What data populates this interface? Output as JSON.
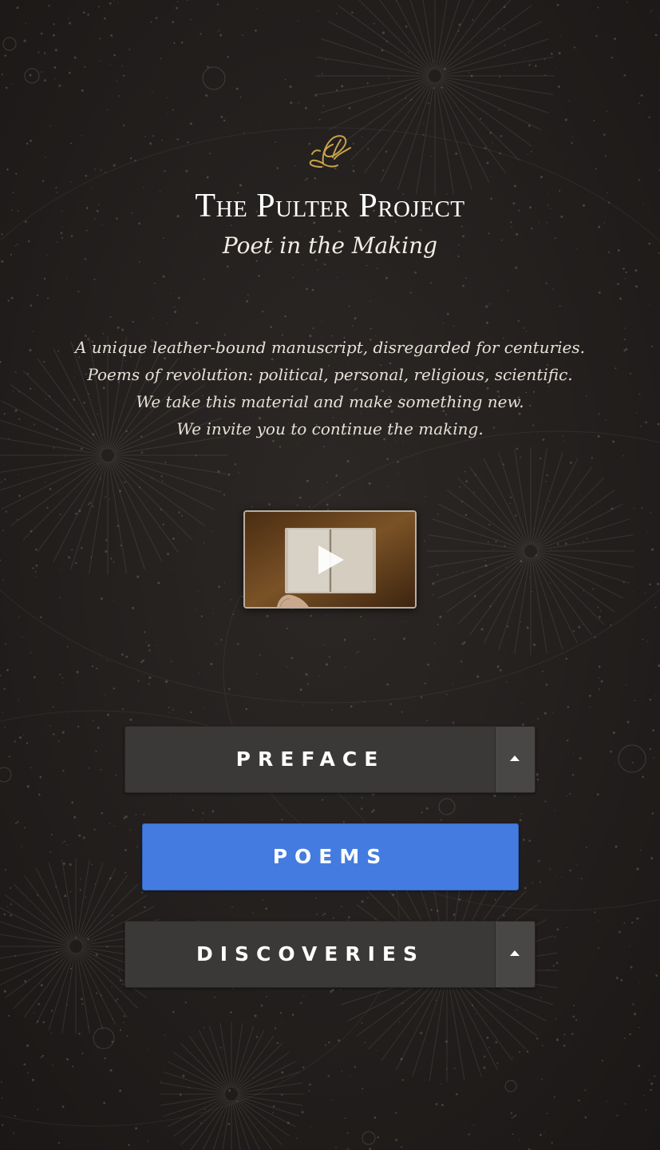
{
  "header": {
    "logo_icon": "quill-monogram-icon",
    "title": "The Pulter Project",
    "subtitle": "Poet in the Making"
  },
  "intro": {
    "lines": [
      "A unique leather-bound manuscript, disregarded for centuries.",
      "Poems of revolution: political, personal, religious, scientific.",
      "We take this material and make something new.",
      "We invite you to continue the making."
    ]
  },
  "video": {
    "play_icon": "play-icon"
  },
  "nav": {
    "preface_label": "PREFACE",
    "poems_label": "POEMS",
    "discoveries_label": "DISCOVERIES",
    "toggle_icon": "caret-up-icon"
  },
  "colors": {
    "background": "#231f1d",
    "accent_blue": "#437be0",
    "button_dark": "#3a3938",
    "logo_gold": "#c9a24a"
  }
}
